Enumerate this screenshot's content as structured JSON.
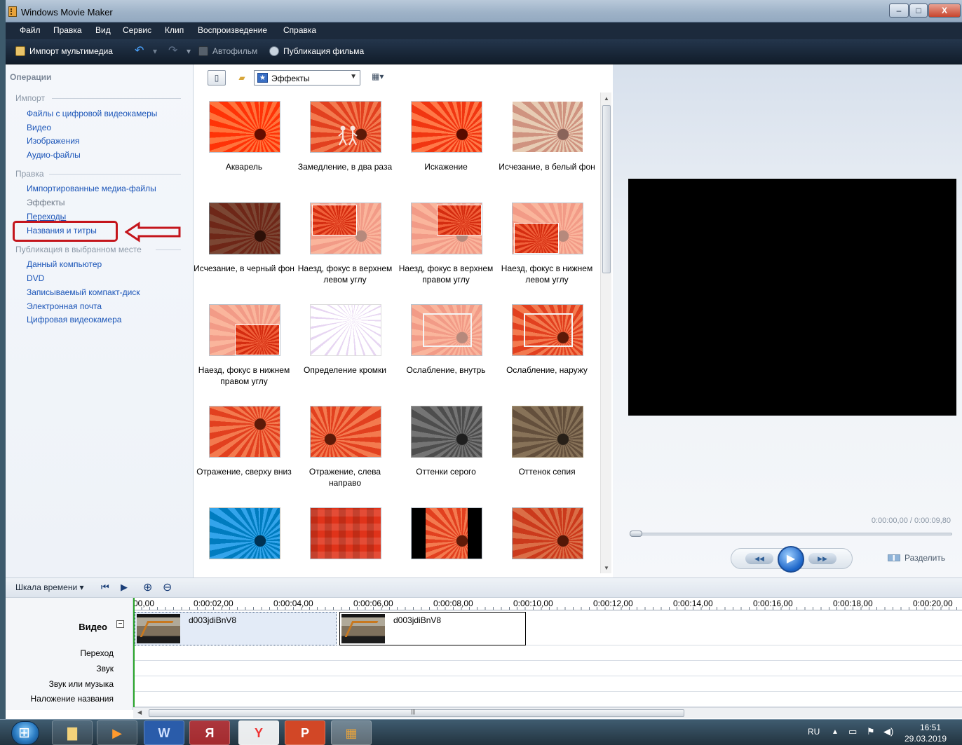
{
  "window": {
    "title": "Windows Movie Maker",
    "minimize": "–",
    "maximize": "□",
    "close": "X"
  },
  "menu": [
    "Файл",
    "Правка",
    "Вид",
    "Сервис",
    "Клип",
    "Воспроизведение",
    "Справка"
  ],
  "toolbar": {
    "import_media": "Импорт мультимедиа",
    "autofilm": "Автофильм",
    "publish": "Публикация фильма"
  },
  "tasks": {
    "header": "Операции",
    "import_title": "Импорт",
    "import_items": [
      "Файлы с цифровой видеокамеры",
      "Видео",
      "Изображения",
      "Аудио-файлы"
    ],
    "edit_title": "Правка",
    "edit_items": [
      "Импортированные медиа-файлы",
      "Эффекты",
      "Переходы",
      "Названия и титры"
    ],
    "publish_title": "Публикация в выбранном месте",
    "publish_items": [
      "Данный компьютер",
      "DVD",
      "Записываемый компакт-диск",
      "Электронная почта",
      "Цифровая видеокамера"
    ]
  },
  "collection": {
    "dropdown": "Эффекты",
    "effects": [
      "Акварель",
      "Замедление, в два раза",
      "Искажение",
      "Исчезание, в белый фон",
      "Исчезание, в черный фон",
      "Наезд, фокус в верхнем левом углу",
      "Наезд, фокус в верхнем правом углу",
      "Наезд, фокус в нижнем левом углу",
      "Наезд, фокус в нижнем правом углу",
      "Определение кромки",
      "Ослабление, внутрь",
      "Ослабление, наружу",
      "Отражение, сверху вниз",
      "Отражение, слева направо",
      "Оттенки серого",
      "Оттенок сепия"
    ]
  },
  "preview": {
    "time": "0:00:00,00 / 0:00:09,80",
    "split": "Разделить"
  },
  "timeline": {
    "view_label": "Шкала времени",
    "ticks": [
      "00,00",
      "0:00:02,00",
      "0:00:04,00",
      "0:00:06,00",
      "0:00:08,00",
      "0:00:10,00",
      "0:00:12,00",
      "0:00:14,00",
      "0:00:16,00",
      "0:00:18,00",
      "0:00:20,00"
    ],
    "tracks": {
      "video": "Видео",
      "transition": "Переход",
      "audio": "Звук",
      "music": "Звук или музыка",
      "title_overlay": "Наложение названия"
    },
    "clips": [
      "d003jdiBnV8",
      "d003jdiBnV8"
    ]
  },
  "taskbar": {
    "lang": "RU",
    "time": "16:51",
    "date": "29.03.2019",
    "word_glyph": "W",
    "yandex_glyph": "Я",
    "yandex_browser_glyph": "Y",
    "powerpoint_glyph": "P"
  }
}
